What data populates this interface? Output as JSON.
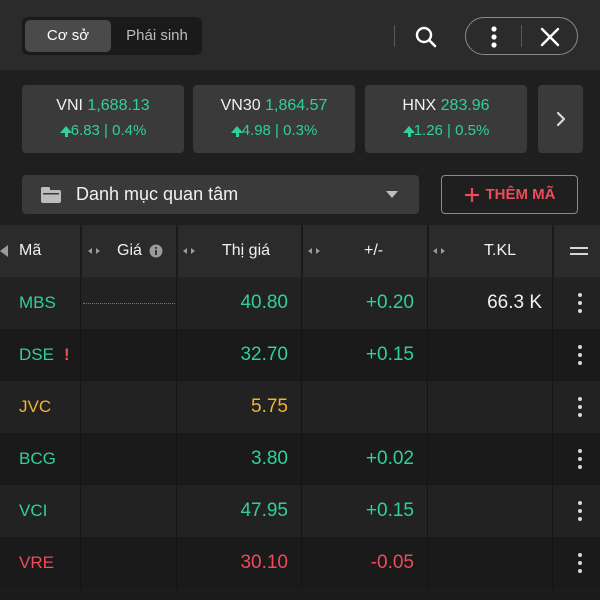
{
  "header": {
    "tabs": [
      {
        "label": "Cơ sở",
        "active": true
      },
      {
        "label": "Phái sinh",
        "active": false
      }
    ],
    "icons": [
      "search-icon",
      "more-vertical-icon",
      "close-icon"
    ]
  },
  "indices": [
    {
      "name": "VNI",
      "value": "1,688.13",
      "change": "6.83 | 0.4%",
      "direction": "up"
    },
    {
      "name": "VN30",
      "value": "1,864.57",
      "change": "4.98 | 0.3%",
      "direction": "up"
    },
    {
      "name": "HNX",
      "value": "283.96",
      "change": "1.26 | 0.5%",
      "direction": "up"
    }
  ],
  "watchlist": {
    "selected": "Danh mục quan tâm",
    "add_label": "THÊM MÃ"
  },
  "table": {
    "headers": {
      "symbol": "Mã",
      "ref": "Giá",
      "price": "Thị giá",
      "change": "+/-",
      "volume": "T.KL"
    },
    "rows": [
      {
        "symbol": "MBS",
        "price": "40.80",
        "change": "+0.20",
        "volume": "66.3 K",
        "status": "up",
        "warning": ""
      },
      {
        "symbol": "DSE",
        "price": "32.70",
        "change": "+0.15",
        "volume": "",
        "status": "up",
        "warning": "!"
      },
      {
        "symbol": "JVC",
        "price": "5.75",
        "change": "",
        "volume": "",
        "status": "ref",
        "warning": ""
      },
      {
        "symbol": "BCG",
        "price": "3.80",
        "change": "+0.02",
        "volume": "",
        "status": "up",
        "warning": ""
      },
      {
        "symbol": "VCI",
        "price": "47.95",
        "change": "+0.15",
        "volume": "",
        "status": "up",
        "warning": ""
      },
      {
        "symbol": "VRE",
        "price": "30.10",
        "change": "-0.05",
        "volume": "",
        "status": "down",
        "warning": ""
      }
    ]
  },
  "colors": {
    "up": "#2ed296",
    "down": "#ef4b5a",
    "ref": "#f0b432",
    "accent_red": "#ef4b5a"
  }
}
